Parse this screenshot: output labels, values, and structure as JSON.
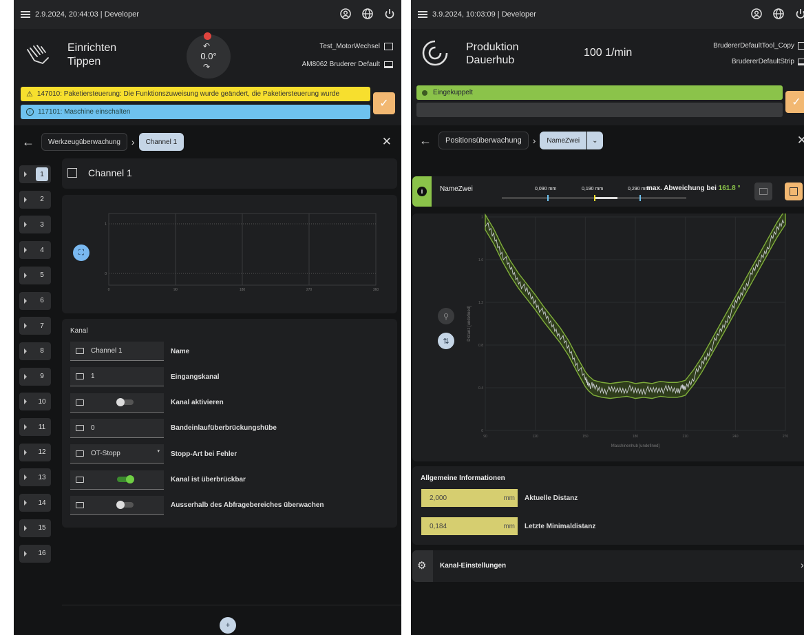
{
  "left": {
    "topbar": {
      "datetime_role": "2.9.2024, 20:44:03 | Developer"
    },
    "header": {
      "mode_line1": "Einrichten",
      "mode_line2": "Tippen",
      "angle": "0.0°",
      "tool": "Test_MotorWechsel",
      "strip": "AM8062 Bruderer Default"
    },
    "alerts": [
      {
        "code_text": "147010: Paketiersteuerung: Die Funktionszuweisung wurde geändert, die Paketiersteuerung wurde"
      },
      {
        "code_text": "117101: Maschine einschalten"
      }
    ],
    "breadcrumb": [
      "Werkzeugüberwachung",
      "Channel 1"
    ],
    "channel_tabs": [
      "1",
      "2",
      "3",
      "4",
      "5",
      "6",
      "7",
      "8",
      "9",
      "10",
      "11",
      "12",
      "13",
      "14",
      "15",
      "16"
    ],
    "channel_title": "Channel 1",
    "chart_data": {
      "type": "line",
      "title": "",
      "xlabel": "",
      "ylabel": "",
      "xlim": [
        0,
        360
      ],
      "x_ticks": [
        "0",
        "90",
        "180",
        "270",
        "360"
      ],
      "y_ticks": [
        "0",
        "1"
      ],
      "series": []
    },
    "kanal": {
      "section_title": "Kanal",
      "fields": [
        {
          "value": "Channel 1",
          "label": "Name"
        },
        {
          "value": "1",
          "label": "Eingangskanal"
        },
        {
          "toggle": false,
          "label": "Kanal aktivieren"
        },
        {
          "value": "0",
          "label": "Bandeinlaufüberbrückungshübe"
        },
        {
          "value": "OT-Stopp",
          "label": "Stopp-Art bei Fehler"
        },
        {
          "toggle": true,
          "label": "Kanal ist überbrückbar"
        },
        {
          "toggle": false,
          "label": "Ausserhalb des Abfragebereiches überwachen"
        }
      ]
    },
    "add_button": "+"
  },
  "right": {
    "topbar": {
      "datetime_role": "3.9.2024, 10:03:09 | Developer"
    },
    "header": {
      "mode_line1": "Produktion",
      "mode_line2": "Dauerhub",
      "speed": "100 1/min",
      "tool": "BrudererDefaultTool_Copy",
      "strip": "BrudererDefaultStrip"
    },
    "status": "Eingekuppelt",
    "breadcrumb": [
      "Positionsüberwachung",
      "NameZwei"
    ],
    "info_bar": {
      "name": "NameZwei",
      "val1": "0,090",
      "val2": "0,190",
      "val3": "0,290",
      "unit": "mm",
      "max_label": "max. Abweichung bei",
      "max_value": "161.8 °",
      "slider_marker": 0.5
    },
    "chart_data": {
      "type": "line",
      "title": "",
      "xlabel": "Maschinenhub [undefined]",
      "ylabel": "Distanz [undefined]",
      "xlim": [
        90,
        270
      ],
      "ylim": [
        0,
        2
      ],
      "x_ticks": [
        "90",
        "120",
        "150",
        "180",
        "210",
        "240",
        "270"
      ],
      "y_ticks": [
        "2",
        "1.6",
        "1.2",
        "0.8",
        "0.4",
        "0"
      ],
      "series": [
        {
          "name": "",
          "x": [
            90,
            95,
            100,
            105,
            110,
            115,
            120,
            125,
            130,
            135,
            140,
            145,
            150,
            152,
            155,
            160,
            165,
            170,
            175,
            180,
            185,
            190,
            195,
            200,
            205,
            208,
            210,
            215,
            220,
            225,
            230,
            235,
            240,
            245,
            250,
            255,
            260,
            265,
            270
          ],
          "y": [
            1.95,
            1.82,
            1.66,
            1.52,
            1.4,
            1.3,
            1.2,
            1.09,
            0.99,
            0.89,
            0.77,
            0.62,
            0.48,
            0.44,
            0.4,
            0.38,
            0.37,
            0.38,
            0.39,
            0.37,
            0.38,
            0.37,
            0.39,
            0.38,
            0.38,
            0.39,
            0.4,
            0.5,
            0.62,
            0.76,
            0.9,
            1.04,
            1.18,
            1.32,
            1.46,
            1.6,
            1.74,
            1.88,
            2.0
          ]
        }
      ],
      "band_halfwidth": 0.07
    },
    "allgemeine": {
      "title": "Allgemeine Informationen",
      "rows": [
        {
          "value": "2,000",
          "unit": "mm",
          "label": "Aktuelle Distanz"
        },
        {
          "value": "0,184",
          "unit": "mm",
          "label": "Letzte Minimaldistanz"
        }
      ]
    },
    "kanal_settings": "Kanal-Einstellungen"
  }
}
